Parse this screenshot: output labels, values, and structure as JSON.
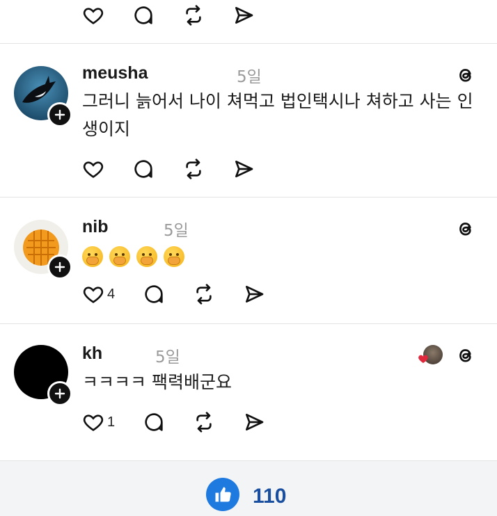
{
  "icons": {
    "like": "heart-icon",
    "reply": "comment-icon",
    "repost": "repost-icon",
    "share": "send-icon",
    "app": "threads-icon",
    "follow": "plus-icon"
  },
  "colors": {
    "accent_like": "#1f7ae0",
    "like_count": "#1a4fa0",
    "heart": "#e0283c"
  },
  "posts": [
    {
      "username": "meusha",
      "time": "5일",
      "text": "그러니 늙어서 나이 쳐먹고 법인택시나 쳐하고 사는 인생이지",
      "likes": ""
    },
    {
      "username": "nib",
      "time": "5일",
      "emoji_count": 4,
      "likes": "4"
    },
    {
      "username": "kh",
      "time": "5일",
      "text": "ㅋㅋㅋㅋ 팩력배군요",
      "likes": "1"
    }
  ],
  "footer": {
    "like_total": "110"
  }
}
